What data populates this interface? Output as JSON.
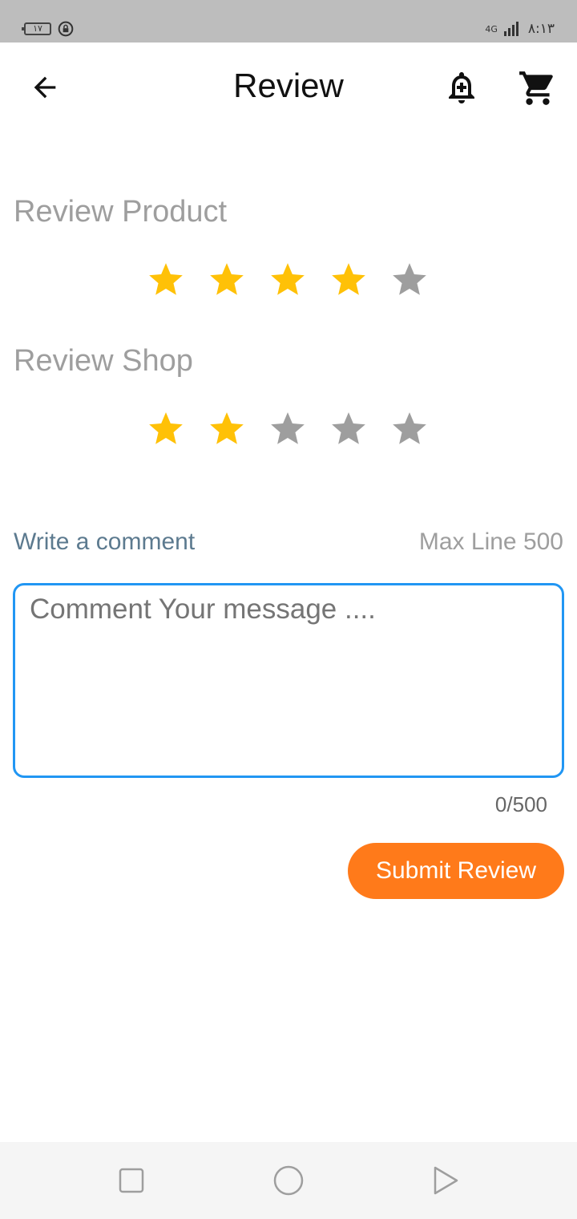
{
  "status_bar": {
    "battery": "١٧",
    "network": "4G",
    "time": "٨:١٣"
  },
  "header": {
    "title": "Review"
  },
  "sections": {
    "product": {
      "label": "Review Product",
      "rating": 4,
      "max": 5
    },
    "shop": {
      "label": "Review Shop",
      "rating": 2,
      "max": 5
    }
  },
  "comment": {
    "label": "Write a comment",
    "max_label": "Max Line 500",
    "placeholder": "Comment Your message ....",
    "counter": "0/500"
  },
  "submit_label": "Submit Review",
  "colors": {
    "accent": "#ff7a1a",
    "star_filled": "#ffc107",
    "star_empty": "#9e9e9e",
    "focus_border": "#2196f3"
  }
}
